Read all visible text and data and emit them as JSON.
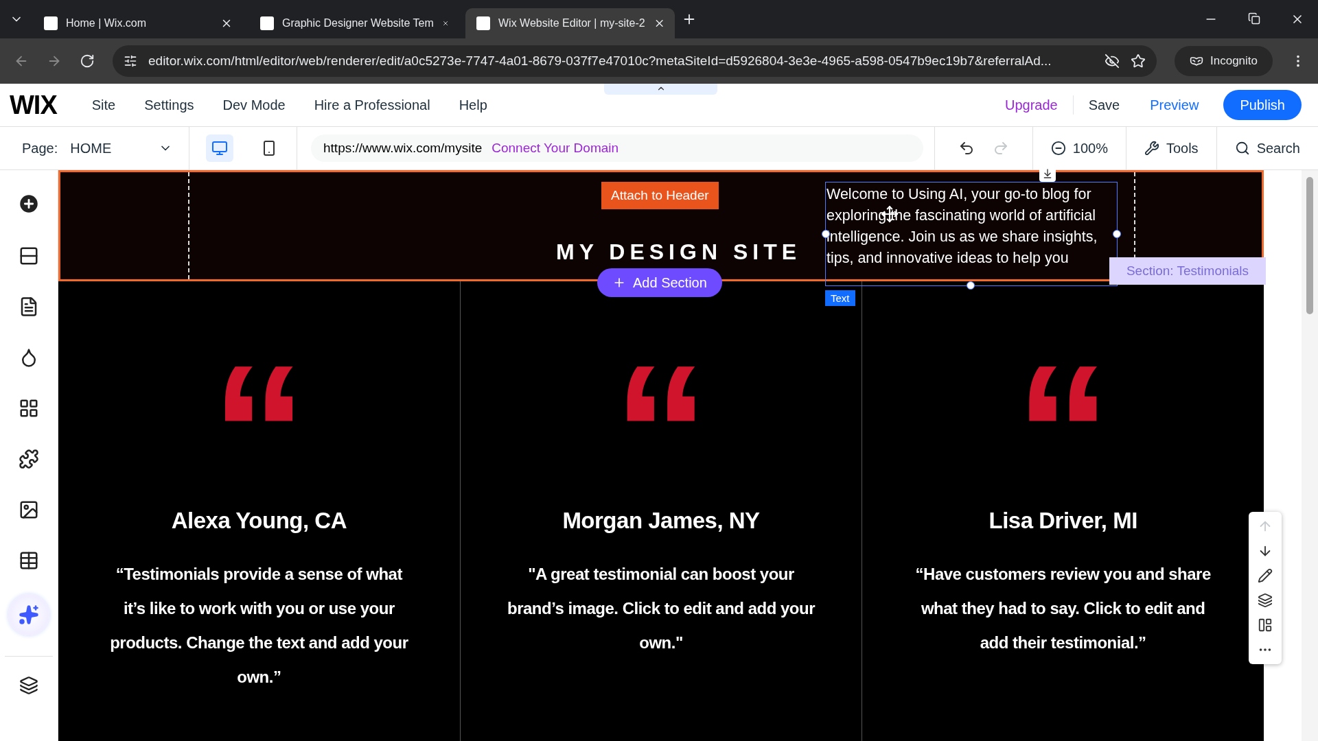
{
  "browser": {
    "tabs": [
      {
        "title": "Home | Wix.com",
        "selected": false
      },
      {
        "title": "Graphic Designer Website Tem",
        "selected": false
      },
      {
        "title": "Wix Website Editor | my-site-2",
        "selected": true
      }
    ],
    "url": "editor.wix.com/html/editor/web/renderer/edit/a0c5273e-7747-4a01-8679-037f7e47010c?metaSiteId=d5926804-3e3e-4965-a598-0547b9ec19b7&referralAd...",
    "profile": "Incognito"
  },
  "editor": {
    "logo": "WIX",
    "menu": [
      "Site",
      "Settings",
      "Dev Mode",
      "Hire a Professional",
      "Help"
    ],
    "upgrade": "Upgrade",
    "save": "Save",
    "preview": "Preview",
    "publish": "Publish"
  },
  "toolbar": {
    "page_label": "Page:",
    "page": "HOME",
    "devices": [
      {
        "kind": "desktop",
        "selected": true
      },
      {
        "kind": "mobile",
        "selected": false
      }
    ],
    "site_url": "https://www.wix.com/mysite",
    "connect": "Connect Your Domain",
    "history": [
      {
        "kind": "undo",
        "disabled": false
      },
      {
        "kind": "redo",
        "disabled": true
      }
    ],
    "zoom": "100%",
    "tools": "Tools",
    "search": "Search"
  },
  "header": {
    "attach": "Attach to Header",
    "site_title": "MY DESIGN SITE",
    "add_section": "Add Section",
    "selected_text": "Welcome to Using AI, your go-to blog for exploring the fascinating world of artificial intelligence. Join us as we share insights, tips, and innovative ideas to help you",
    "element_tag": "Text",
    "section_label": "Section: Testimonials"
  },
  "testimonials": [
    {
      "mark": "“",
      "name": "Alexa Young, CA",
      "quote": "“Testimonials provide a sense of what it’s like to work with you or use your products. Change the text and add your own.”"
    },
    {
      "mark": "“",
      "name": "Morgan James, NY",
      "quote": "\"A great testimonial can boost your brand’s image. Click to edit and add your own.\""
    },
    {
      "mark": "“",
      "name": "Lisa Driver, MI",
      "quote": "“Have customers review you and share what they had to say. Click to edit and add their testimonial.”"
    }
  ],
  "float_tools": [
    {
      "kind": "up",
      "disabled": true
    },
    {
      "kind": "down",
      "disabled": false
    },
    {
      "kind": "edit",
      "disabled": false
    },
    {
      "kind": "layers",
      "disabled": false
    },
    {
      "kind": "panel",
      "disabled": false
    },
    {
      "kind": "more",
      "disabled": false
    }
  ]
}
